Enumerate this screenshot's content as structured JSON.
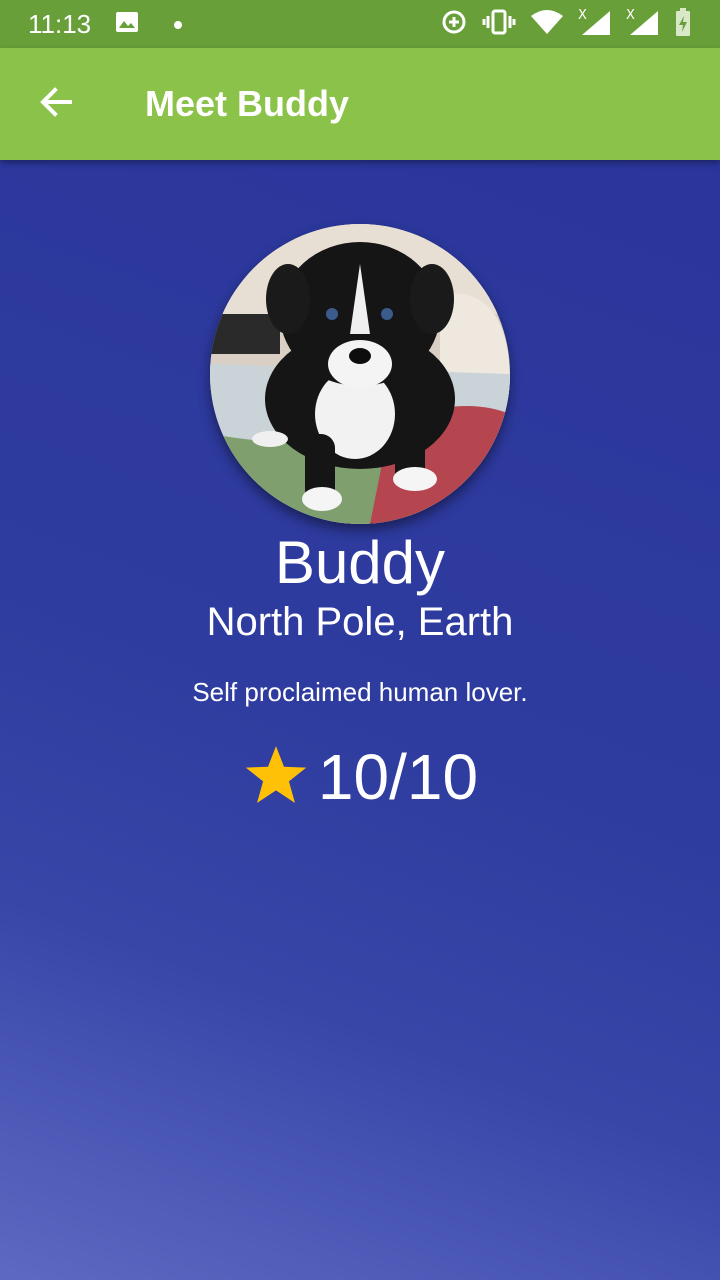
{
  "status_bar": {
    "time": "11:13",
    "icons": [
      "image-icon",
      "dot-icon",
      "data-saver-icon",
      "vibrate-icon",
      "wifi-icon",
      "signal-icon-1",
      "signal-icon-2",
      "battery-charging-icon"
    ]
  },
  "app_bar": {
    "title": "Meet Buddy",
    "back_icon": "arrow-back-icon",
    "color": "#8bc34a"
  },
  "profile": {
    "name": "Buddy",
    "location": "North Pole, Earth",
    "description": "Self proclaimed human lover.",
    "rating": "10/10",
    "rating_icon": "star-icon",
    "star_color": "#ffc107"
  }
}
